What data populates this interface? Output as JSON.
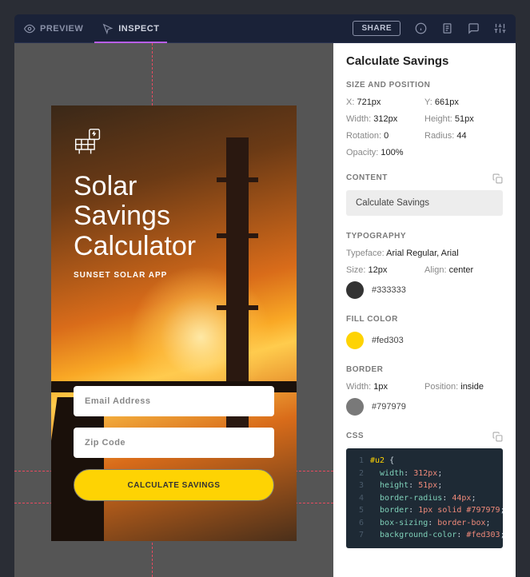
{
  "toolbar": {
    "tabs": {
      "preview": "PREVIEW",
      "inspect": "INSPECT"
    },
    "share": "SHARE"
  },
  "mockup": {
    "title": "Solar\nSavings\nCalculator",
    "subtitle": "SUNSET SOLAR APP",
    "email_placeholder": "Email Address",
    "zip_placeholder": "Zip Code",
    "cta": "CALCULATE SAVINGS"
  },
  "inspector": {
    "title": "Calculate Savings",
    "size_position": {
      "heading": "SIZE AND POSITION",
      "x": {
        "label": "X: ",
        "value": "721px"
      },
      "y": {
        "label": "Y: ",
        "value": "661px"
      },
      "width": {
        "label": "Width: ",
        "value": "312px"
      },
      "height": {
        "label": "Height: ",
        "value": "51px"
      },
      "rotation": {
        "label": "Rotation: ",
        "value": "0"
      },
      "radius": {
        "label": "Radius: ",
        "value": "44"
      },
      "opacity": {
        "label": "Opacity: ",
        "value": "100%"
      }
    },
    "content": {
      "heading": "CONTENT",
      "value": "Calculate Savings"
    },
    "typography": {
      "heading": "TYPOGRAPHY",
      "typeface": {
        "label": "Typeface: ",
        "value": "Arial Regular, Arial"
      },
      "size": {
        "label": "Size: ",
        "value": "12px"
      },
      "align": {
        "label": "Align: ",
        "value": "center"
      },
      "color": "#333333"
    },
    "fill": {
      "heading": "FILL COLOR",
      "color": "#fed303"
    },
    "border": {
      "heading": "BORDER",
      "width": {
        "label": "Width: ",
        "value": "1px"
      },
      "position": {
        "label": "Position: ",
        "value": "inside"
      },
      "color": "#797979"
    },
    "css": {
      "heading": "CSS",
      "lines": [
        {
          "n": "1",
          "t": "sel",
          "text": "#u2 {"
        },
        {
          "n": "2",
          "k": "  width",
          "v": "312px"
        },
        {
          "n": "3",
          "k": "  height",
          "v": "51px"
        },
        {
          "n": "4",
          "k": "  border-radius",
          "v": "44px"
        },
        {
          "n": "5",
          "k": "  border",
          "v": "1px solid #797979"
        },
        {
          "n": "6",
          "k": "  box-sizing",
          "v": "border-box"
        },
        {
          "n": "7",
          "k": "  background-color",
          "v": "#fed303"
        }
      ]
    }
  },
  "colors": {
    "cta_fill": "#fed303",
    "cta_border": "#797979",
    "typo_color": "#333333"
  },
  "chart_data": null
}
